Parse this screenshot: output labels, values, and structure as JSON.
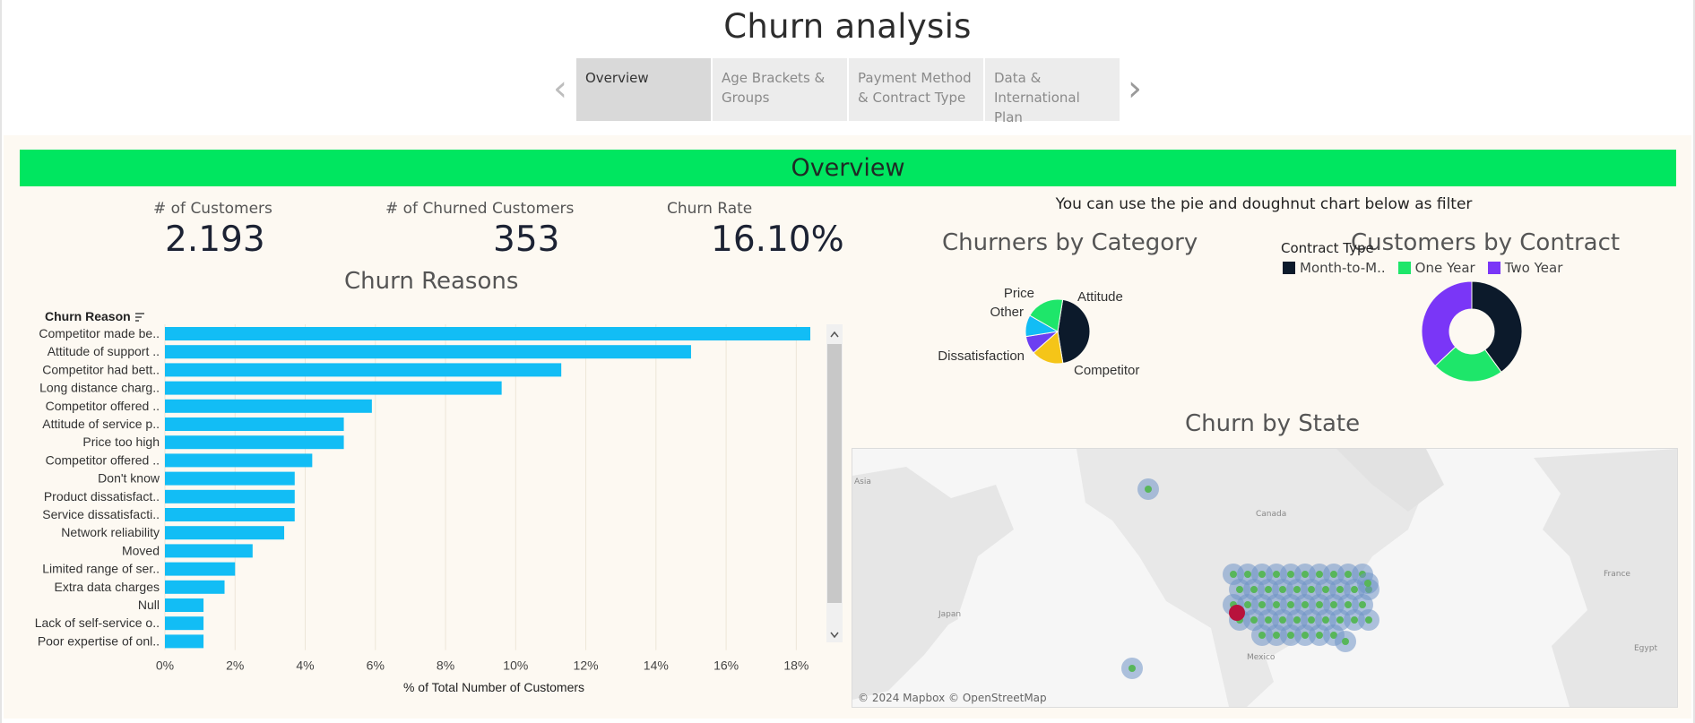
{
  "title": "Churn analysis",
  "tabs": [
    {
      "label": "Overview",
      "active": true
    },
    {
      "label": "Age Brackets & Groups",
      "active": false
    },
    {
      "label": "Payment Method & Contract Type",
      "active": false
    },
    {
      "label": "Data & International Plan",
      "active": false
    }
  ],
  "banner": "Overview",
  "kpis": [
    {
      "label": "# of Customers",
      "value": "2.193"
    },
    {
      "label": "# of Churned Customers",
      "value": "353"
    },
    {
      "label": "Churn Rate",
      "value": "16.10%"
    }
  ],
  "filter_note": "You can use the pie and doughnut chart below as filter",
  "sections": {
    "churn_reasons": "Churn Reasons",
    "category": "Churners by Category",
    "contract": "Customers by Contract",
    "state": "Churn by State"
  },
  "legend": {
    "title": "Contract Type",
    "items": [
      {
        "label": "Month-to-M..",
        "color": "#0c1a2b"
      },
      {
        "label": "One Year",
        "color": "#1ee66a"
      },
      {
        "label": "Two Year",
        "color": "#7a36f7"
      }
    ]
  },
  "map": {
    "credit": "© 2024 Mapbox © OpenStreetMap",
    "labels": [
      "Canada",
      "Japan",
      "Mexico",
      "France",
      "Egypt",
      "Asia"
    ]
  },
  "colors": {
    "banner": "#00e660",
    "bar": "#12bdf5",
    "map_bubble": "#6f93c6",
    "map_dot": "#58b65a",
    "map_highlight": "#b8123c"
  },
  "chart_data": [
    {
      "type": "bar",
      "orientation": "horizontal",
      "title": "Churn Reasons",
      "dimension_header": "Churn Reason",
      "xlabel": "% of Total Number of Customers",
      "x_ticks": [
        "0%",
        "2%",
        "4%",
        "6%",
        "8%",
        "10%",
        "12%",
        "14%",
        "16%",
        "18%"
      ],
      "xlim": [
        0,
        18.4
      ],
      "grid": true,
      "categories": [
        "Competitor made be..",
        "Attitude of support ..",
        "Competitor had bett..",
        "Long distance charg..",
        "Competitor offered ..",
        "Attitude of service p..",
        "Price too high",
        "Competitor offered ..",
        "Don't know",
        "Product dissatisfact..",
        "Service dissatisfacti..",
        "Network reliability",
        "Moved",
        "Limited range of ser..",
        "Extra data charges",
        "Null",
        "Lack of self-service o..",
        "Poor expertise of onl.."
      ],
      "values": [
        18.4,
        15.0,
        11.3,
        9.6,
        5.9,
        5.1,
        5.1,
        4.2,
        3.7,
        3.7,
        3.7,
        3.4,
        2.5,
        2.0,
        1.7,
        1.1,
        1.1,
        1.1
      ]
    },
    {
      "type": "pie",
      "title": "Churners by Category",
      "categories": [
        "Competitor",
        "Dissatisfaction",
        "Other",
        "Price",
        "Attitude"
      ],
      "values": [
        44.9,
        16.1,
        9.0,
        10.8,
        19.2
      ],
      "colors": [
        "#0c1a2b",
        "#f5c518",
        "#6c3ff2",
        "#12bdf5",
        "#1ee66a"
      ]
    },
    {
      "type": "pie",
      "subtype": "donut",
      "title": "Customers by Contract",
      "categories": [
        "Month-to-M..",
        "One Year",
        "Two Year"
      ],
      "values": [
        40,
        23,
        37
      ],
      "colors": [
        "#0c1a2b",
        "#1ee66a",
        "#7a36f7"
      ]
    }
  ]
}
